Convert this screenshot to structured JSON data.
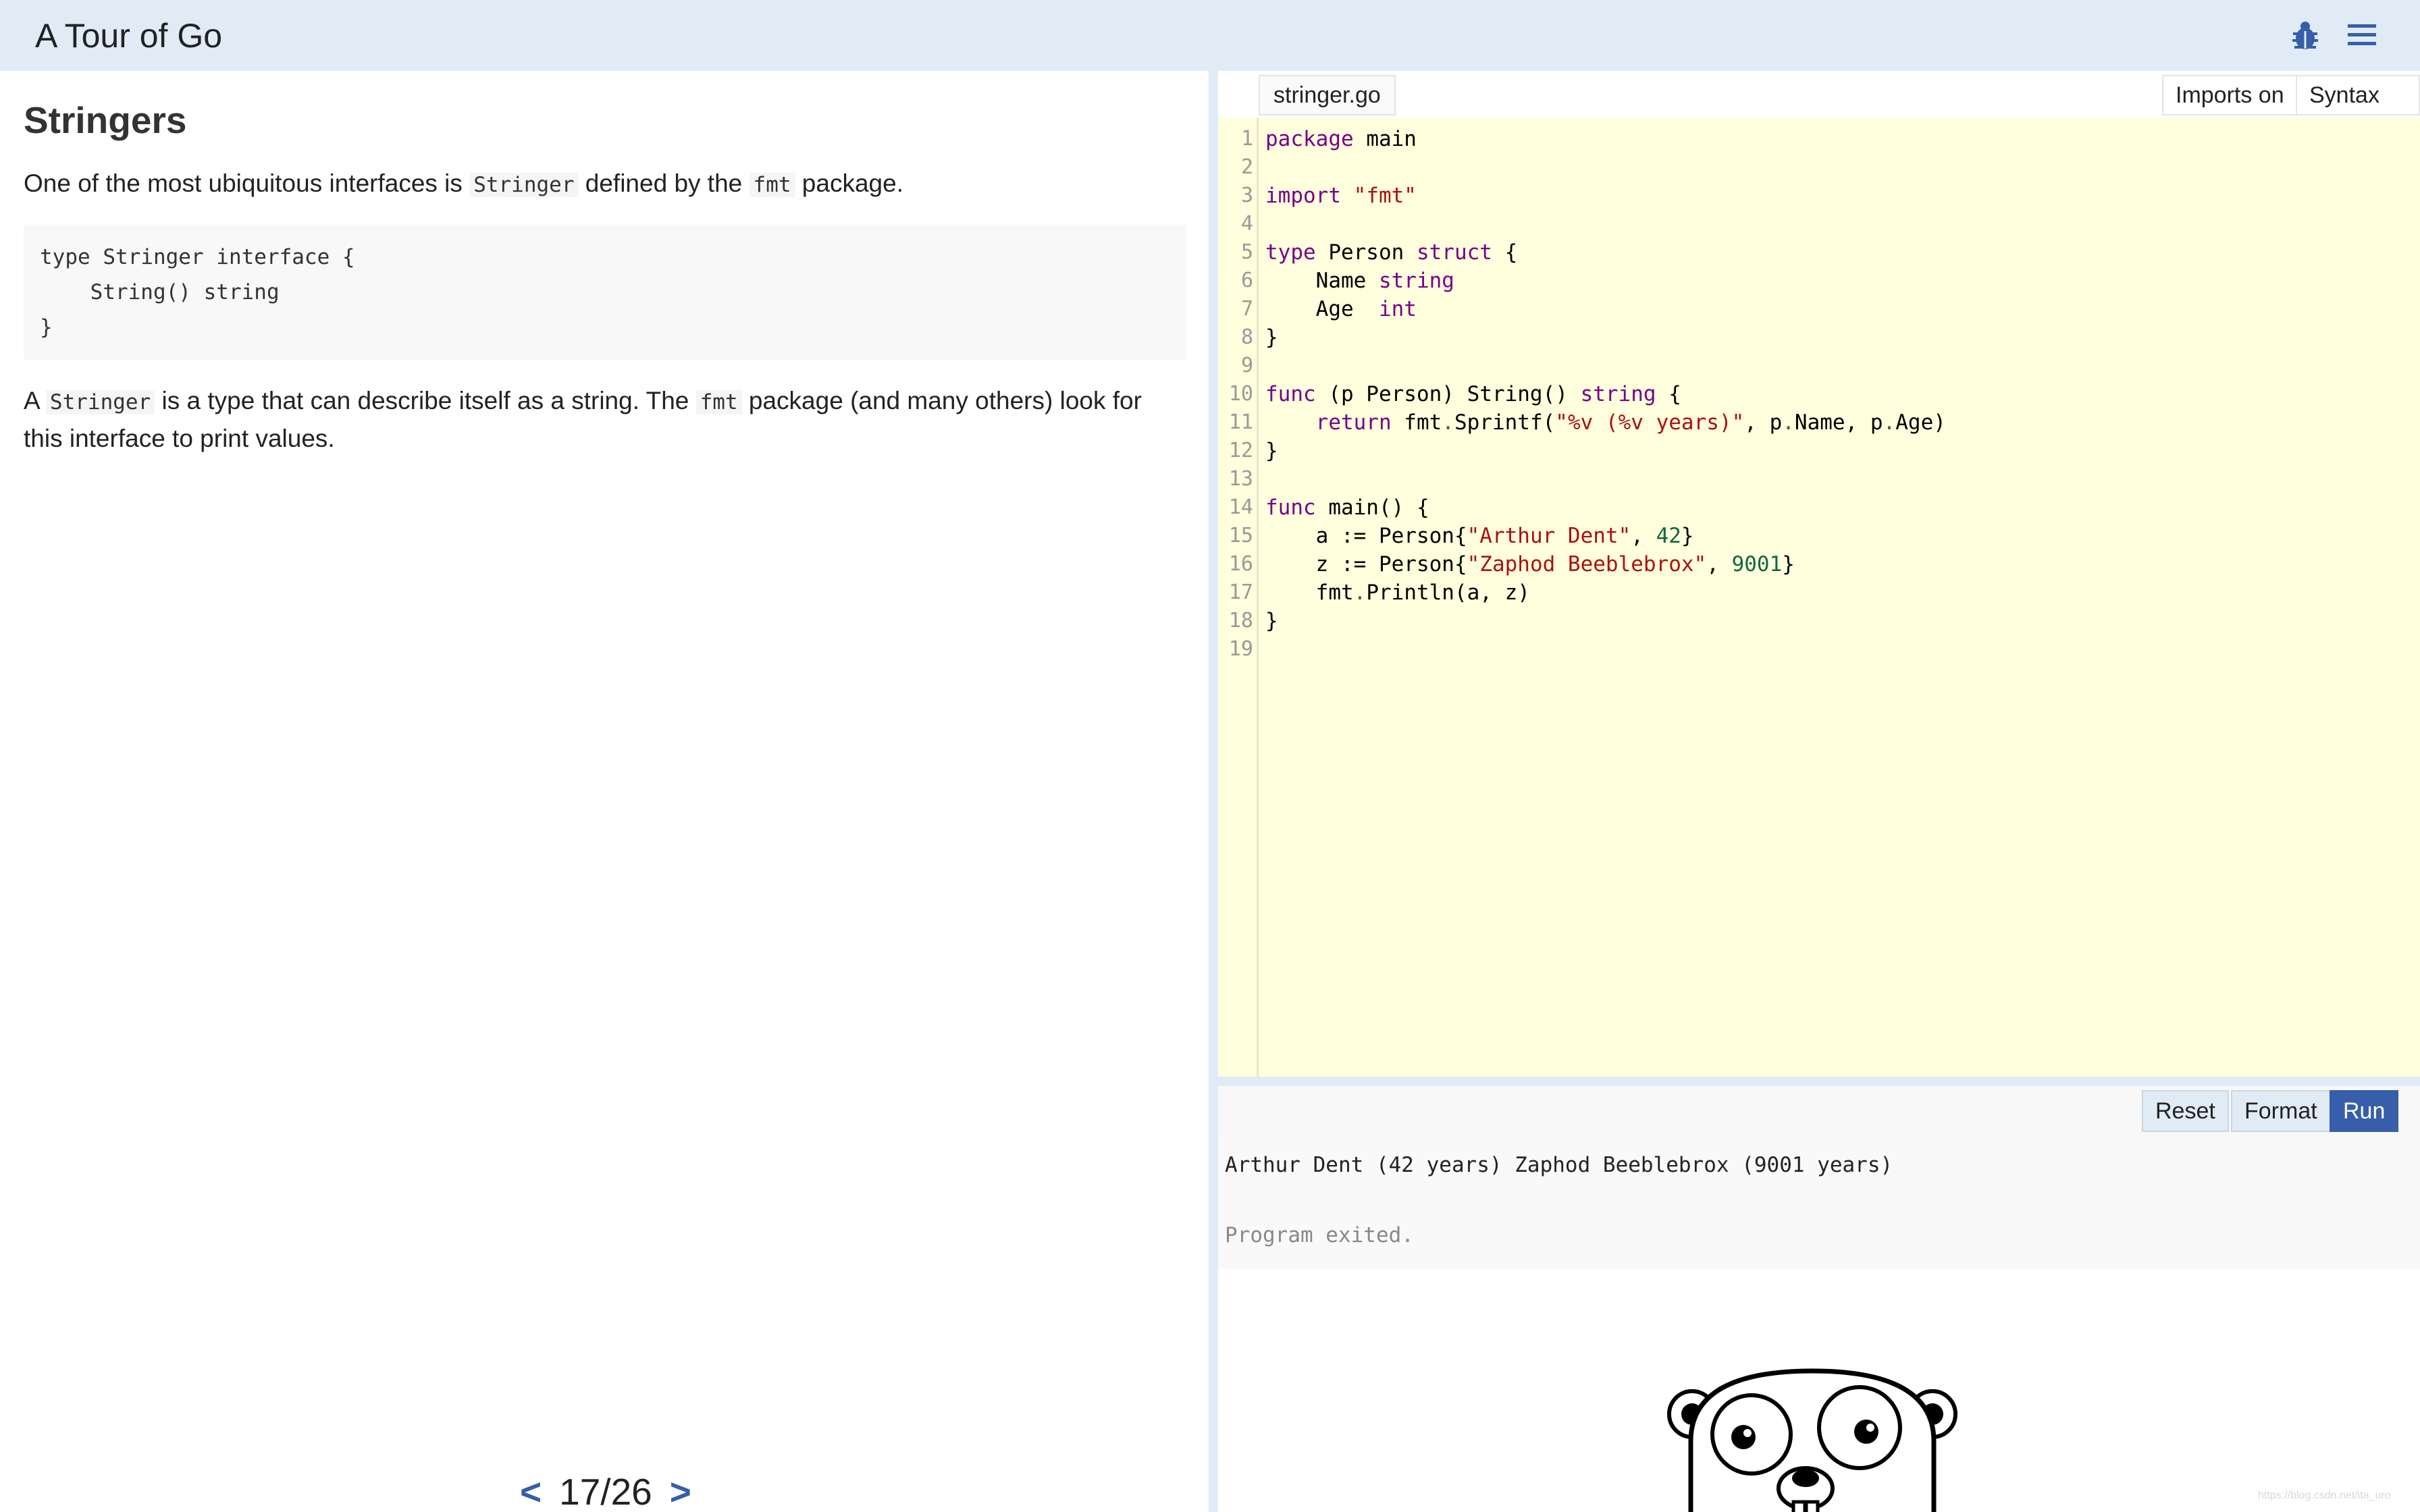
{
  "header": {
    "title": "A Tour of Go"
  },
  "lesson": {
    "title": "Stringers",
    "p1": {
      "before": "One of the most ubiquitous interfaces is ",
      "code1": "Stringer",
      "middle": " defined by the ",
      "code2": "fmt",
      "after": " package."
    },
    "codeblock": "type Stringer interface {\n    String() string\n}",
    "p2": {
      "before": "A ",
      "code1": "Stringer",
      "middle": " is a type that can describe itself as a string. The ",
      "code2": "fmt",
      "after": " package (and many others) look for this interface to print values."
    }
  },
  "pager": {
    "prev": "<",
    "current": "17/26",
    "next": ">"
  },
  "editor": {
    "file_tab": "stringer.go",
    "imports_toggle": "Imports on",
    "syntax_toggle": "Syntax on",
    "line_numbers": "1\n2\n3\n4\n5\n6\n7\n8\n9\n10\n11\n12\n13\n14\n15\n16\n17\n18\n19"
  },
  "actions": {
    "reset": "Reset",
    "format": "Format",
    "run": "Run"
  },
  "output": {
    "text": "Arthur Dent (42 years) Zaphod Beeblebrox (9001 years)",
    "status": "Program exited."
  },
  "watermark": "https://blog.csdn.net/ita_uro",
  "colors": {
    "header_bg": "#e0ebf5",
    "accent": "#375eab",
    "editor_bg": "#ffffdd"
  }
}
